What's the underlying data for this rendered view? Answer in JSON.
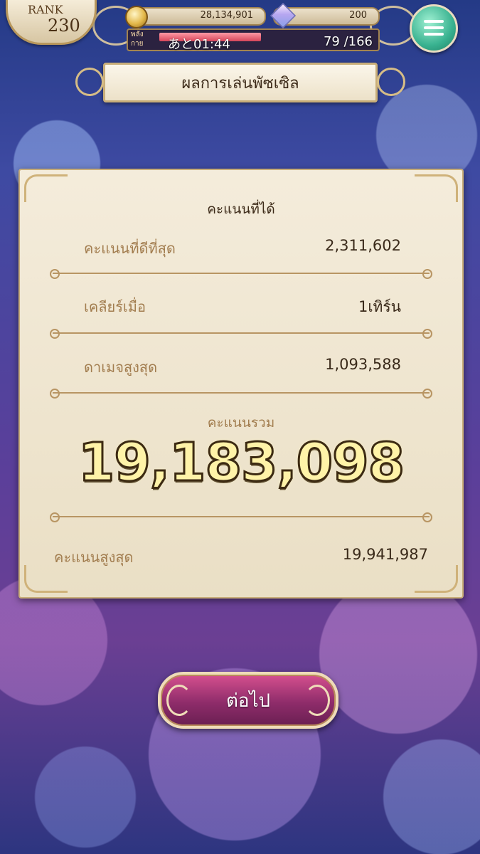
{
  "hud": {
    "rank_label": "RANK",
    "rank_value": "230",
    "coins": "28,134,901",
    "gems": "200",
    "stamina_label": "พลัง\nกาย",
    "stamina_timer": "あと01:44",
    "stamina_count": "79 /166",
    "stamina_fraction": 0.476
  },
  "title": "ผลการเล่นพัซเซิล",
  "results": {
    "heading": "คะแนนที่ได้",
    "rows": [
      {
        "label": "คะแนนที่ดีที่สุด",
        "value": "2,311,602"
      },
      {
        "label": "เคลียร์เมื่อ",
        "value": "1เทิร์น"
      },
      {
        "label": "ดาเมจสูงสุด",
        "value": "1,093,588"
      }
    ],
    "total_label": "คะแนนรวม",
    "total_value": "19,183,098",
    "best_label": "คะแนนสูงสุด",
    "best_value": "19,941,987"
  },
  "next_button": "ต่อไป",
  "colors": {
    "accent": "#c9ae79",
    "button": "#8e2c6a",
    "menu": "#39b290"
  }
}
